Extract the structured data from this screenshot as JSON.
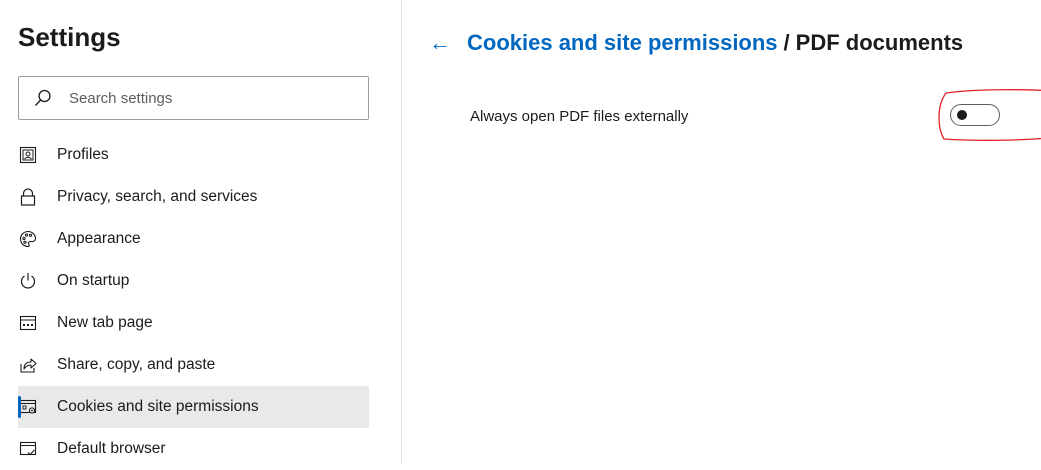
{
  "sidebar": {
    "title": "Settings",
    "search": {
      "placeholder": "Search settings",
      "icon": "search-icon"
    },
    "items": [
      {
        "label": "Profiles",
        "icon": "profile-icon"
      },
      {
        "label": "Privacy, search, and services",
        "icon": "lock-icon"
      },
      {
        "label": "Appearance",
        "icon": "palette-icon"
      },
      {
        "label": "On startup",
        "icon": "power-icon"
      },
      {
        "label": "New tab page",
        "icon": "new-tab-icon"
      },
      {
        "label": "Share, copy, and paste",
        "icon": "share-icon"
      },
      {
        "label": "Cookies and site permissions",
        "icon": "site-permissions-icon",
        "active": true
      },
      {
        "label": "Default browser",
        "icon": "default-browser-icon"
      }
    ]
  },
  "main": {
    "breadcrumb": {
      "back_icon": "back-arrow-icon",
      "back_glyph": "←",
      "parent": "Cookies and site permissions",
      "separator": "/",
      "current": "PDF documents"
    },
    "setting": {
      "label": "Always open PDF files externally",
      "toggle_on": false
    }
  },
  "colors": {
    "accent": "#0067c0",
    "active_bg": "#e9e9e9",
    "highlight": "#e0202a"
  }
}
